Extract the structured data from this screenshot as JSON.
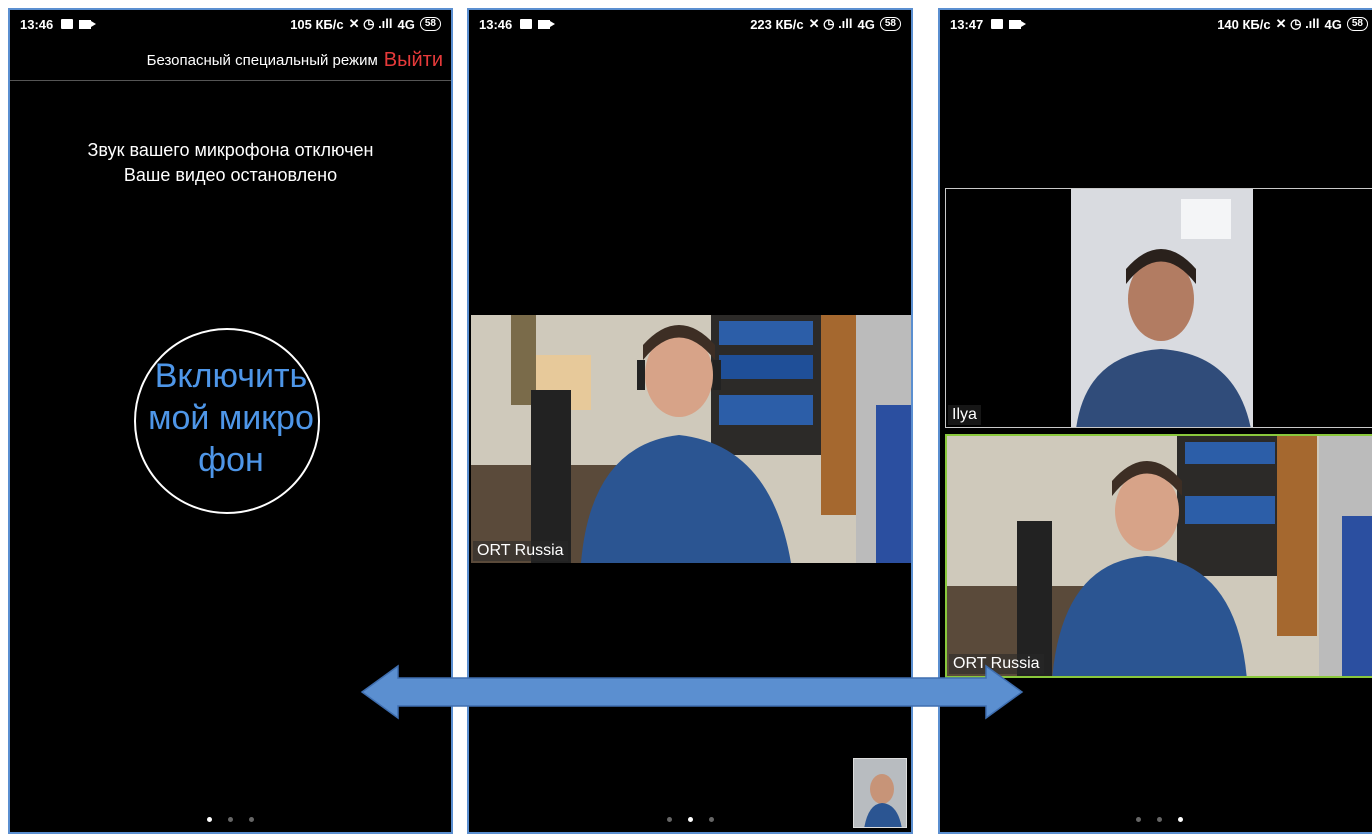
{
  "screens": [
    {
      "status": {
        "time": "13:46",
        "network": "105 КБ/с",
        "signal": "4G",
        "battery": "58"
      },
      "safe_mode_label": "Безопасный специальный режим",
      "exit_label": "Выйти",
      "mute_line1": "Звук вашего микрофона отключен",
      "mute_line2": "Ваше видео остановлено",
      "mic_button_label": "Включить мой микрофон",
      "page_index": 0
    },
    {
      "status": {
        "time": "13:46",
        "network": "223 КБ/с",
        "signal": "4G",
        "battery": "58"
      },
      "participant_name": "ORT Russia",
      "page_index": 1
    },
    {
      "status": {
        "time": "13:47",
        "network": "140 КБ/с",
        "signal": "4G",
        "battery": "58"
      },
      "participants": [
        "Ilya",
        "ORT Russia"
      ],
      "page_index": 2
    }
  ],
  "colors": {
    "frame": "#5b8fd0",
    "exit": "#e63a3a",
    "mic_text": "#4e96e8",
    "active_speaker": "#8ac83c",
    "arrow": "#5b8fd0"
  }
}
